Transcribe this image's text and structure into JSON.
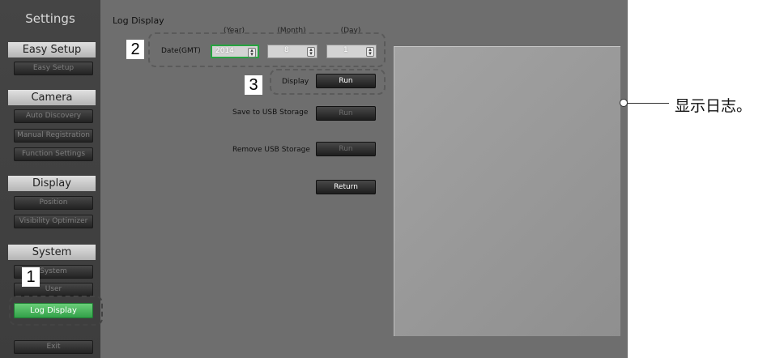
{
  "sidebar": {
    "title": "Settings",
    "sections": [
      {
        "label": "Easy Setup",
        "items": [
          "Easy Setup"
        ]
      },
      {
        "label": "Camera",
        "items": [
          "Auto Discovery",
          "Manual Registration",
          "Function Settings"
        ]
      },
      {
        "label": "Display",
        "items": [
          "Position",
          "Visibility Optimizer"
        ]
      },
      {
        "label": "System",
        "items": [
          "System",
          "User",
          "Log Display"
        ]
      }
    ],
    "exit_label": "Exit",
    "active_item": "Log Display"
  },
  "main": {
    "title": "Log Display",
    "date_label": "Date(GMT)",
    "year_header": "(Year)",
    "month_header": "(Month)",
    "day_header": "(Day)",
    "year_value": "2014",
    "month_value": "8",
    "day_value": "1",
    "display_label": "Display",
    "save_label": "Save to USB Storage",
    "remove_label": "Remove USB Storage",
    "run_label": "Run",
    "return_label": "Return"
  },
  "annotations": {
    "step1": "1",
    "step2": "2",
    "step3": "3",
    "callout": "显示日志。"
  },
  "colors": {
    "active_green": "#3fb356",
    "background": "#6e6e6e",
    "log_panel": "#9a9a9a"
  }
}
